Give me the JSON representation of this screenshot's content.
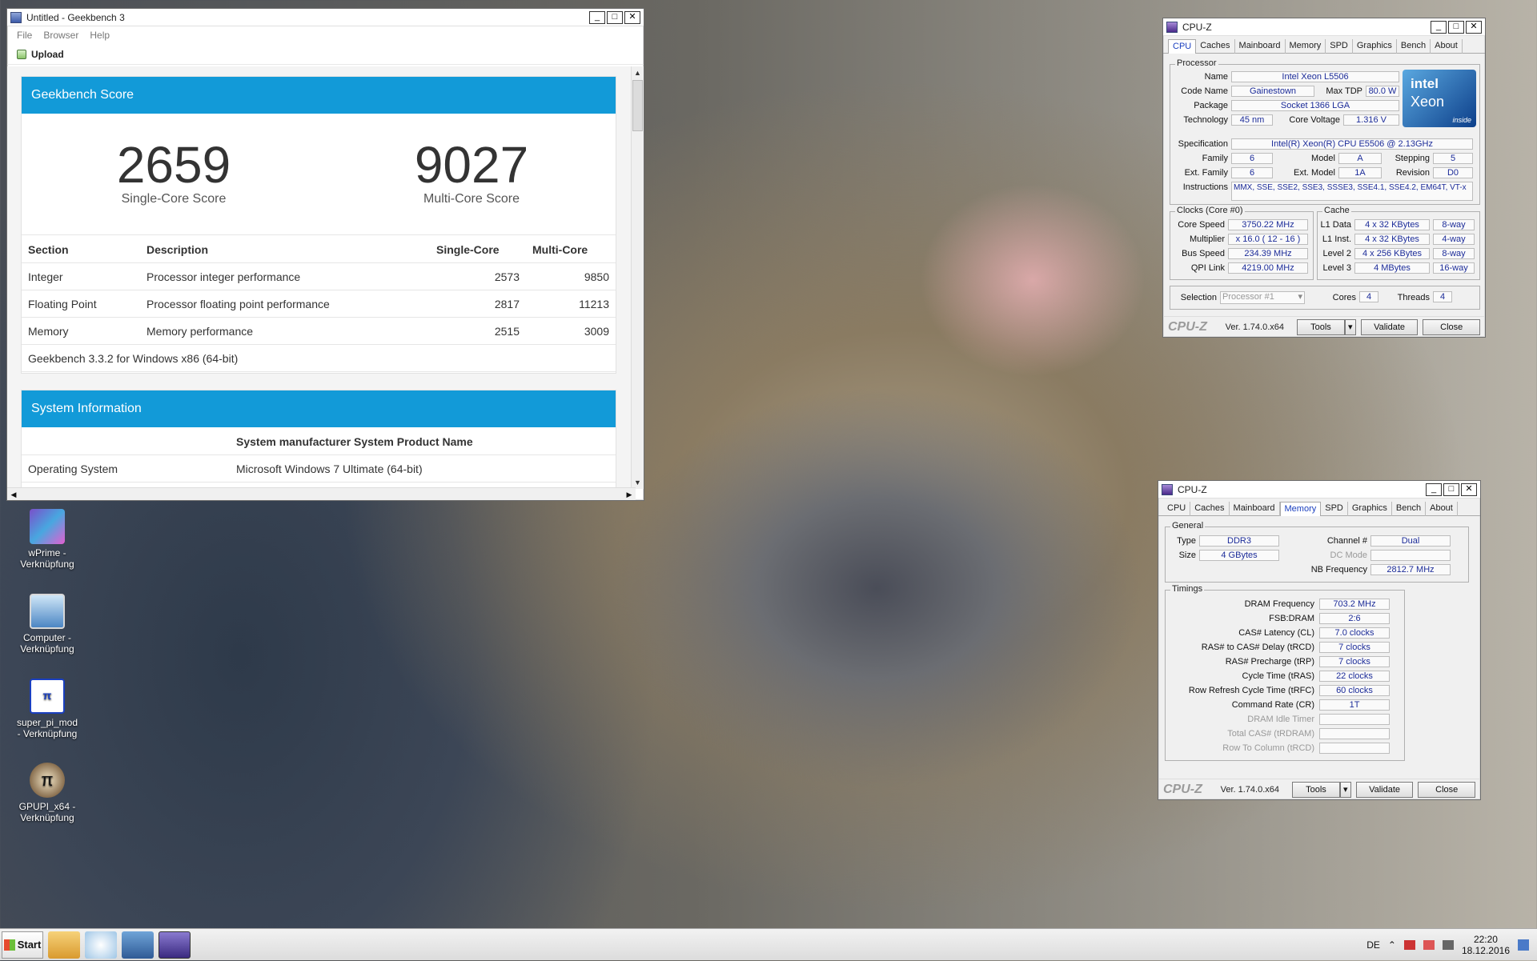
{
  "desktop": {
    "icons": [
      {
        "label": "wPrime - Verknüpfung",
        "icon": "wprime-icon"
      },
      {
        "label": "Computer - Verknüpfung",
        "icon": "computer-icon"
      },
      {
        "label": "super_pi_mod - Verknüpfung",
        "icon": "superpi-icon"
      },
      {
        "label": "GPUPI_x64 - Verknüpfung",
        "icon": "gpupi-icon"
      }
    ]
  },
  "geekbench": {
    "title": "Untitled - Geekbench 3",
    "menu": [
      "File",
      "Browser",
      "Help"
    ],
    "upload_label": "Upload",
    "score_header": "Geekbench Score",
    "single_score": "2659",
    "single_label": "Single-Core Score",
    "multi_score": "9027",
    "multi_label": "Multi-Core Score",
    "table_headers": [
      "Section",
      "Description",
      "Single-Core",
      "Multi-Core"
    ],
    "rows": [
      {
        "section": "Integer",
        "description": "Processor integer performance",
        "single": "2573",
        "multi": "9850"
      },
      {
        "section": "Floating Point",
        "description": "Processor floating point performance",
        "single": "2817",
        "multi": "11213"
      },
      {
        "section": "Memory",
        "description": "Memory performance",
        "single": "2515",
        "multi": "3009"
      }
    ],
    "version": "Geekbench 3.3.2 for Windows x86 (64-bit)",
    "sysinfo_header": "System Information",
    "sysinfo_title": "System manufacturer System Product Name",
    "os_label": "Operating System",
    "os_value": "Microsoft Windows 7 Ultimate (64-bit)",
    "accent_color": "#129ad8"
  },
  "cpuz_cpu": {
    "title": "CPU-Z",
    "tabs": [
      "CPU",
      "Caches",
      "Mainboard",
      "Memory",
      "SPD",
      "Graphics",
      "Bench",
      "About"
    ],
    "processor_group": "Processor",
    "name_label": "Name",
    "name": "Intel Xeon L5506",
    "codename_label": "Code Name",
    "codename": "Gainestown",
    "maxtdp_label": "Max TDP",
    "maxtdp": "80.0 W",
    "package_label": "Package",
    "package": "Socket 1366 LGA",
    "technology_label": "Technology",
    "technology": "45 nm",
    "corevoltage_label": "Core Voltage",
    "corevoltage": "1.316 V",
    "spec_label": "Specification",
    "spec": "Intel(R) Xeon(R) CPU        E5506  @ 2.13GHz",
    "family_label": "Family",
    "family": "6",
    "model_label": "Model",
    "model": "A",
    "stepping_label": "Stepping",
    "stepping": "5",
    "extfamily_label": "Ext. Family",
    "extfamily": "6",
    "extmodel_label": "Ext. Model",
    "extmodel": "1A",
    "revision_label": "Revision",
    "revision": "D0",
    "instructions_label": "Instructions",
    "instructions": "MMX, SSE, SSE2, SSE3, SSSE3, SSE4.1, SSE4.2, EM64T, VT-x",
    "clocks_group": "Clocks (Core #0)",
    "corespeed_label": "Core Speed",
    "corespeed": "3750.22 MHz",
    "multiplier_label": "Multiplier",
    "multiplier": "x 16.0 ( 12 - 16 )",
    "busspeed_label": "Bus Speed",
    "busspeed": "234.39 MHz",
    "qpilink_label": "QPI Link",
    "qpilink": "4219.00 MHz",
    "cache_group": "Cache",
    "l1d_label": "L1 Data",
    "l1d": "4 x 32 KBytes",
    "l1d_way": "8-way",
    "l1i_label": "L1 Inst.",
    "l1i": "4 x 32 KBytes",
    "l1i_way": "4-way",
    "l2_label": "Level 2",
    "l2": "4 x 256 KBytes",
    "l2_way": "8-way",
    "l3_label": "Level 3",
    "l3": "4 MBytes",
    "l3_way": "16-way",
    "selection_label": "Selection",
    "selection": "Processor #1",
    "cores_label": "Cores",
    "cores": "4",
    "threads_label": "Threads",
    "threads": "4",
    "logo_text": "CPU-Z",
    "version": "Ver. 1.74.0.x64",
    "tools_label": "Tools",
    "validate_label": "Validate",
    "close_label": "Close",
    "intel_brand": "intel",
    "intel_product": "Xeon",
    "intel_inside": "inside"
  },
  "cpuz_mem": {
    "title": "CPU-Z",
    "tabs": [
      "CPU",
      "Caches",
      "Mainboard",
      "Memory",
      "SPD",
      "Graphics",
      "Bench",
      "About"
    ],
    "general_group": "General",
    "type_label": "Type",
    "type": "DDR3",
    "size_label": "Size",
    "size": "4 GBytes",
    "channel_label": "Channel #",
    "channel": "Dual",
    "dcmode_label": "DC Mode",
    "dcmode": "",
    "nbfreq_label": "NB Frequency",
    "nbfreq": "2812.7 MHz",
    "timings_group": "Timings",
    "timings": [
      {
        "label": "DRAM Frequency",
        "value": "703.2 MHz",
        "dim": false
      },
      {
        "label": "FSB:DRAM",
        "value": "2:6",
        "dim": false
      },
      {
        "label": "CAS# Latency (CL)",
        "value": "7.0 clocks",
        "dim": false
      },
      {
        "label": "RAS# to CAS# Delay (tRCD)",
        "value": "7 clocks",
        "dim": false
      },
      {
        "label": "RAS# Precharge (tRP)",
        "value": "7 clocks",
        "dim": false
      },
      {
        "label": "Cycle Time (tRAS)",
        "value": "22 clocks",
        "dim": false
      },
      {
        "label": "Row Refresh Cycle Time (tRFC)",
        "value": "60 clocks",
        "dim": false
      },
      {
        "label": "Command Rate (CR)",
        "value": "1T",
        "dim": false
      },
      {
        "label": "DRAM Idle Timer",
        "value": "",
        "dim": true
      },
      {
        "label": "Total CAS# (tRDRAM)",
        "value": "",
        "dim": true
      },
      {
        "label": "Row To Column (tRCD)",
        "value": "",
        "dim": true
      }
    ],
    "logo_text": "CPU-Z",
    "version": "Ver. 1.74.0.x64",
    "tools_label": "Tools",
    "validate_label": "Validate",
    "close_label": "Close"
  },
  "taskbar": {
    "start_label": "Start",
    "language": "DE",
    "time": "22:20",
    "date": "18.12.2016"
  }
}
